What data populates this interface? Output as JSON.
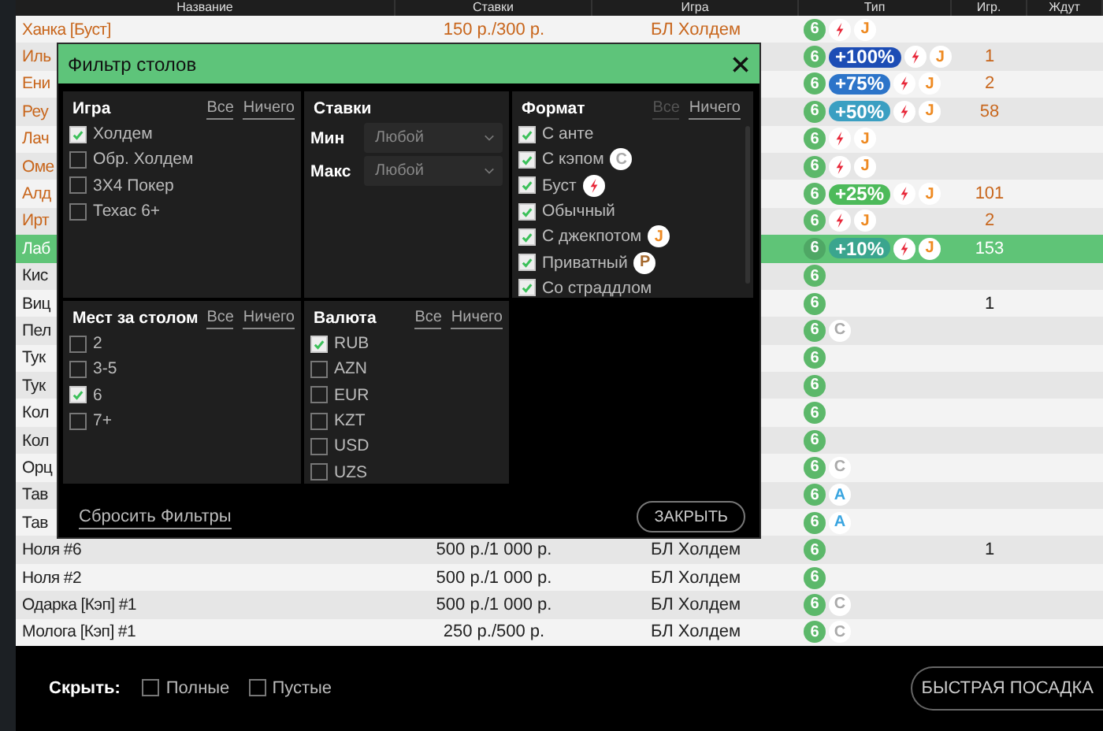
{
  "table": {
    "columns": [
      "Название",
      "Ставки",
      "Игра",
      "Тип",
      "Игр.",
      "Ждут"
    ],
    "rows": [
      {
        "name": "Ханка [Буст]",
        "stakes": "150 р./300 р.",
        "game": "БЛ Холдем",
        "kind": "boost",
        "selected": false,
        "badges": [
          {
            "kind": "seats",
            "text": "6"
          },
          {
            "kind": "boost"
          },
          {
            "kind": "jackpot",
            "text": "J"
          }
        ]
      },
      {
        "name": "Иль",
        "kind": "boost",
        "selected": false,
        "players": "1",
        "badges": [
          {
            "kind": "seats",
            "text": "6"
          },
          {
            "kind": "bonus",
            "text": "+100%",
            "color": "#1d4db5"
          },
          {
            "kind": "boost"
          },
          {
            "kind": "jackpot",
            "text": "J"
          }
        ]
      },
      {
        "name": "Ени",
        "kind": "boost",
        "selected": false,
        "players": "2",
        "badges": [
          {
            "kind": "seats",
            "text": "6"
          },
          {
            "kind": "bonus",
            "text": "+75%",
            "color": "#2c74c9"
          },
          {
            "kind": "boost"
          },
          {
            "kind": "jackpot",
            "text": "J"
          }
        ]
      },
      {
        "name": "Реу",
        "kind": "boost",
        "selected": false,
        "players": "58",
        "badges": [
          {
            "kind": "seats",
            "text": "6"
          },
          {
            "kind": "bonus",
            "text": "+50%",
            "color": "#3a9fc2"
          },
          {
            "kind": "boost"
          },
          {
            "kind": "jackpot",
            "text": "J"
          }
        ]
      },
      {
        "name": "Лач",
        "kind": "boost",
        "selected": false,
        "badges": [
          {
            "kind": "seats",
            "text": "6"
          },
          {
            "kind": "boost"
          },
          {
            "kind": "jackpot",
            "text": "J"
          }
        ]
      },
      {
        "name": "Оме",
        "kind": "boost",
        "selected": false,
        "badges": [
          {
            "kind": "seats",
            "text": "6"
          },
          {
            "kind": "boost"
          },
          {
            "kind": "jackpot",
            "text": "J"
          }
        ]
      },
      {
        "name": "Алд",
        "kind": "boost",
        "selected": false,
        "players": "101",
        "badges": [
          {
            "kind": "seats",
            "text": "6"
          },
          {
            "kind": "bonus",
            "text": "+25%",
            "color": "#4dba5a"
          },
          {
            "kind": "boost"
          },
          {
            "kind": "jackpot",
            "text": "J"
          }
        ]
      },
      {
        "name": "Ирт",
        "kind": "boost",
        "selected": false,
        "players": "2",
        "badges": [
          {
            "kind": "seats",
            "text": "6"
          },
          {
            "kind": "boost"
          },
          {
            "kind": "jackpot",
            "text": "J"
          }
        ]
      },
      {
        "name": "Лаб",
        "kind": "boost",
        "selected": true,
        "players": "153",
        "badges": [
          {
            "kind": "seats",
            "text": "6"
          },
          {
            "kind": "bonus",
            "text": "+10%",
            "color": "#3aa58e"
          },
          {
            "kind": "boost"
          },
          {
            "kind": "jackpot",
            "text": "J"
          }
        ]
      },
      {
        "name": "Кис",
        "kind": "regular",
        "selected": false,
        "badges": [
          {
            "kind": "seats",
            "text": "6"
          }
        ]
      },
      {
        "name": "Виц",
        "kind": "regular",
        "selected": false,
        "players": "1",
        "badges": [
          {
            "kind": "seats",
            "text": "6"
          }
        ]
      },
      {
        "name": "Пел",
        "kind": "regular",
        "selected": false,
        "badges": [
          {
            "kind": "seats",
            "text": "6"
          },
          {
            "kind": "cap",
            "text": "C"
          }
        ]
      },
      {
        "name": "Тук",
        "kind": "regular",
        "selected": false,
        "badges": [
          {
            "kind": "seats",
            "text": "6"
          }
        ]
      },
      {
        "name": "Тук",
        "kind": "regular",
        "selected": false,
        "badges": [
          {
            "kind": "seats",
            "text": "6"
          }
        ]
      },
      {
        "name": "Кол",
        "kind": "regular",
        "selected": false,
        "badges": [
          {
            "kind": "seats",
            "text": "6"
          }
        ]
      },
      {
        "name": "Кол",
        "kind": "regular",
        "selected": false,
        "badges": [
          {
            "kind": "seats",
            "text": "6"
          }
        ]
      },
      {
        "name": "Орц",
        "kind": "regular",
        "selected": false,
        "badges": [
          {
            "kind": "seats",
            "text": "6"
          },
          {
            "kind": "cap",
            "text": "C"
          }
        ]
      },
      {
        "name": "Тав",
        "kind": "regular",
        "selected": false,
        "badges": [
          {
            "kind": "seats",
            "text": "6"
          },
          {
            "kind": "letter",
            "text": "A"
          }
        ]
      },
      {
        "name": "Тав",
        "kind": "regular",
        "selected": false,
        "badges": [
          {
            "kind": "seats",
            "text": "6"
          },
          {
            "kind": "letter",
            "text": "A"
          }
        ]
      },
      {
        "name": "Ноля #6",
        "stakes": "500 р./1 000 р.",
        "game": "БЛ Холдем",
        "kind": "regular",
        "selected": false,
        "players": "1",
        "badges": [
          {
            "kind": "seats",
            "text": "6"
          }
        ]
      },
      {
        "name": "Ноля #2",
        "stakes": "500 р./1 000 р.",
        "game": "БЛ Холдем",
        "kind": "regular",
        "selected": false,
        "badges": [
          {
            "kind": "seats",
            "text": "6"
          }
        ]
      },
      {
        "name": "Одарка [Кэп] #1",
        "stakes": "500 р./1 000 р.",
        "game": "БЛ Холдем",
        "kind": "regular",
        "selected": false,
        "badges": [
          {
            "kind": "seats",
            "text": "6"
          },
          {
            "kind": "cap",
            "text": "C"
          }
        ]
      },
      {
        "name": "Молога [Кэп] #1",
        "stakes": "250 р./500 р.",
        "game": "БЛ Холдем",
        "kind": "regular",
        "selected": false,
        "badges": [
          {
            "kind": "seats",
            "text": "6"
          },
          {
            "kind": "cap",
            "text": "C"
          }
        ]
      }
    ]
  },
  "filter": {
    "title": "Фильтр столов",
    "game": {
      "title": "Игра",
      "all": {
        "label": "Все",
        "disabled": false
      },
      "none": {
        "label": "Ничего",
        "disabled": false
      },
      "options": [
        {
          "label": "Холдем",
          "checked": true
        },
        {
          "label": "Обр. Холдем",
          "checked": false
        },
        {
          "label": "3X4 Покер",
          "checked": false
        },
        {
          "label": "Техас 6+",
          "checked": false
        }
      ]
    },
    "stakes": {
      "title": "Ставки",
      "min_label": "Мин",
      "min_value": "Любой",
      "max_label": "Макс",
      "max_value": "Любой"
    },
    "format": {
      "title": "Формат",
      "all": {
        "label": "Все",
        "disabled": true
      },
      "none": {
        "label": "Ничего",
        "disabled": false
      },
      "options": [
        {
          "label": "С анте",
          "checked": true
        },
        {
          "label": "С кэпом",
          "checked": true,
          "badge": {
            "kind": "cap",
            "text": "C"
          }
        },
        {
          "label": "Буст",
          "checked": true,
          "badge": {
            "kind": "boost"
          }
        },
        {
          "label": "Обычный",
          "checked": true
        },
        {
          "label": "С джекпотом",
          "checked": true,
          "badge": {
            "kind": "jackpot",
            "text": "J"
          }
        },
        {
          "label": "Приватный",
          "checked": true,
          "badge": {
            "kind": "private",
            "text": "P"
          }
        },
        {
          "label": "Со страддлом",
          "checked": true
        }
      ]
    },
    "seats": {
      "title": "Мест за столом",
      "all": {
        "label": "Все",
        "disabled": false
      },
      "none": {
        "label": "Ничего",
        "disabled": false
      },
      "options": [
        {
          "label": "2",
          "checked": false
        },
        {
          "label": "3-5",
          "checked": false
        },
        {
          "label": "6",
          "checked": true
        },
        {
          "label": "7+",
          "checked": false
        }
      ]
    },
    "currency": {
      "title": "Валюта",
      "all": {
        "label": "Все",
        "disabled": false
      },
      "none": {
        "label": "Ничего",
        "disabled": false
      },
      "options": [
        {
          "label": "RUB",
          "checked": true
        },
        {
          "label": "AZN",
          "checked": false
        },
        {
          "label": "EUR",
          "checked": false
        },
        {
          "label": "KZT",
          "checked": false
        },
        {
          "label": "USD",
          "checked": false
        },
        {
          "label": "UZS",
          "checked": false
        }
      ]
    },
    "reset": "Сбросить Фильтры",
    "close": "ЗАКРЫТЬ"
  },
  "footer": {
    "hide_label": "Скрыть:",
    "options": [
      {
        "label": "Полные",
        "checked": false
      },
      {
        "label": "Пустые",
        "checked": false
      }
    ],
    "quick_seat": "БЫСТРАЯ ПОСАДКА"
  }
}
